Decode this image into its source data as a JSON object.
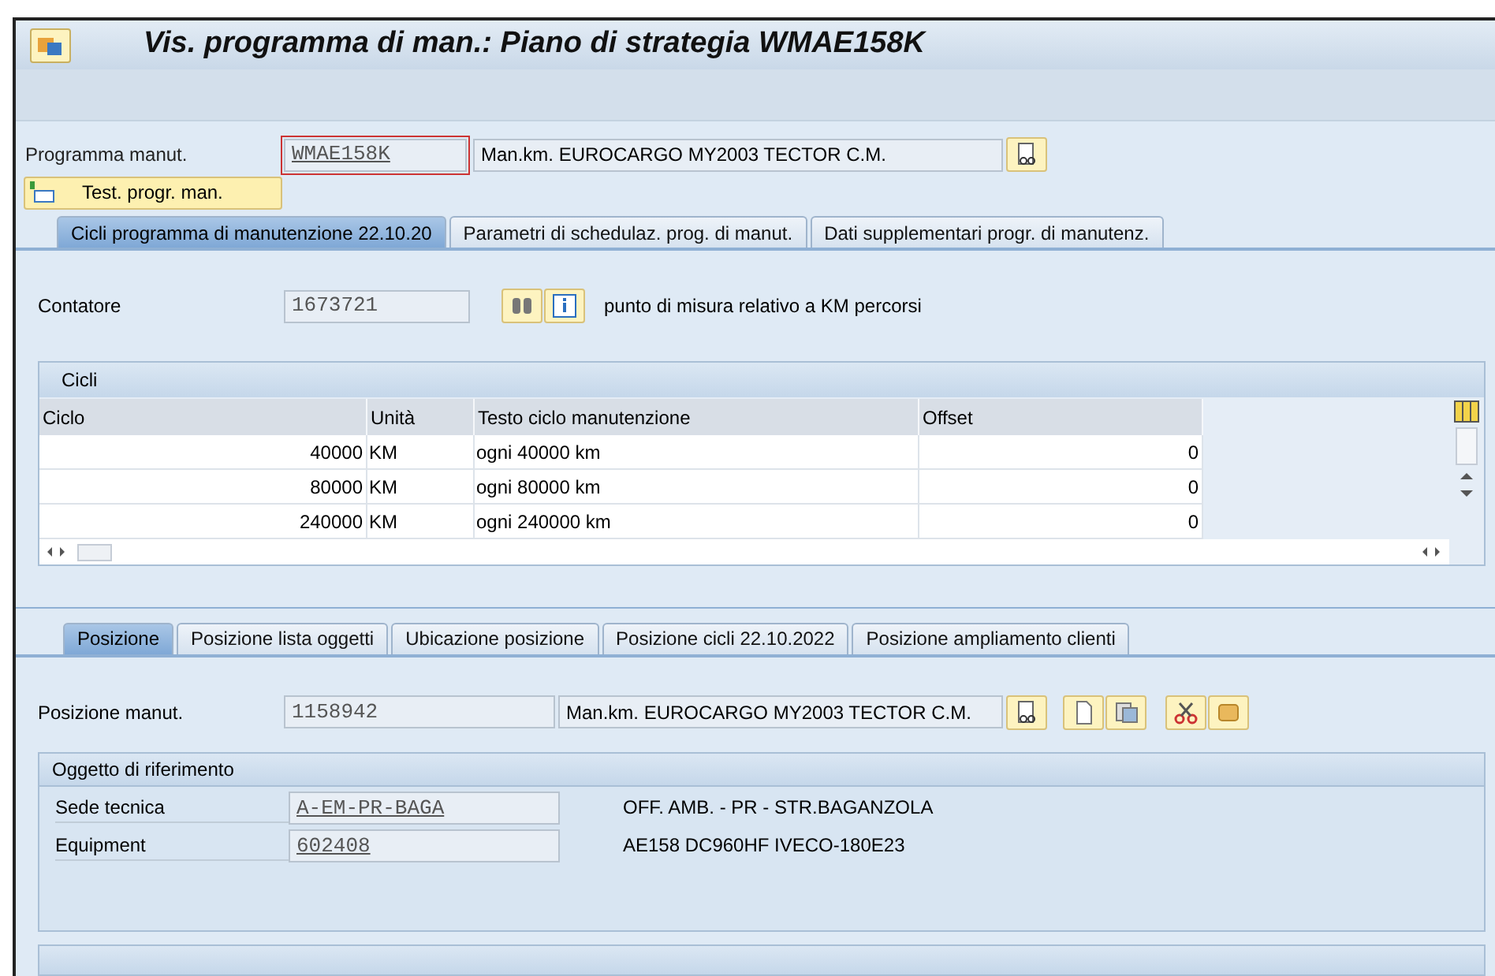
{
  "window": {
    "title": "Vis. programma di man.: Piano di strategia WMAE158K"
  },
  "header": {
    "label": "Programma manut.",
    "value": "WMAE158K",
    "description": "Man.km. EUROCARGO MY2003 TECTOR C.M.",
    "test_button": "Test. progr. man."
  },
  "tabs": [
    {
      "label": "Cicli programma di manutenzione 22.10.20",
      "selected": true
    },
    {
      "label": "Parametri di schedulaz. prog. di manut.",
      "selected": false
    },
    {
      "label": "Dati supplementari progr. di manutenz.",
      "selected": false
    }
  ],
  "counter": {
    "label": "Contatore",
    "value": "1673721",
    "note": "punto di misura relativo a KM percorsi"
  },
  "cycles": {
    "title": "Cicli",
    "columns": [
      "Ciclo",
      "Unità",
      "Testo ciclo manutenzione",
      "Offset"
    ],
    "rows": [
      [
        "40000",
        "KM",
        "ogni 40000 km",
        "0"
      ],
      [
        "80000",
        "KM",
        "ogni 80000 km",
        "0"
      ],
      [
        "240000",
        "KM",
        "ogni 240000 km",
        "0"
      ]
    ]
  },
  "item_tabs": [
    {
      "label": "Posizione",
      "selected": true
    },
    {
      "label": "Posizione lista oggetti",
      "selected": false
    },
    {
      "label": "Ubicazione posizione",
      "selected": false
    },
    {
      "label": "Posizione cicli 22.10.2022",
      "selected": false
    },
    {
      "label": "Posizione ampliamento clienti",
      "selected": false
    }
  ],
  "item": {
    "label": "Posizione manut.",
    "value": "1158942",
    "description": "Man.km. EUROCARGO MY2003 TECTOR C.M."
  },
  "reference": {
    "title": "Oggetto di riferimento",
    "fields": [
      {
        "label": "Sede tecnica",
        "value": "A-EM-PR-BAGA",
        "description": "OFF. AMB. - PR - STR.BAGANZOLA"
      },
      {
        "label": "Equipment",
        "value": "602408",
        "description": "AE158 DC960HF IVECO-180E23"
      }
    ]
  }
}
